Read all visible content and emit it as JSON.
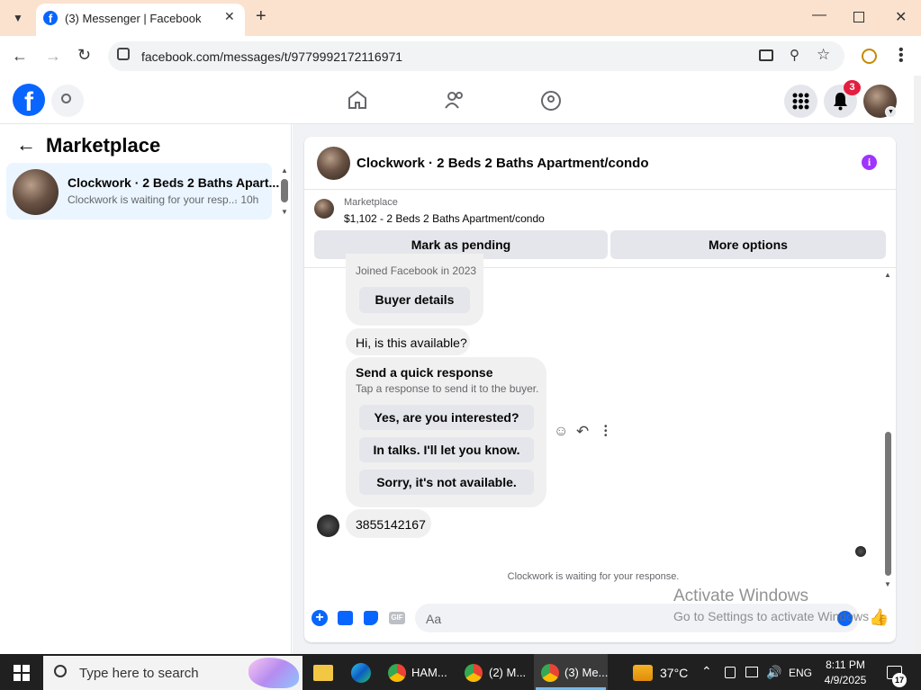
{
  "browser": {
    "tab_title": "(3) Messenger | Facebook",
    "url": "facebook.com/messages/t/9779992172116971"
  },
  "header": {
    "notification_count": "3"
  },
  "sidebar": {
    "title": "Marketplace",
    "conversations": [
      {
        "title": "Clockwork · 2 Beds 2 Baths Apart...",
        "preview": "Clockwork is waiting for your resp...",
        "time": "· 10h"
      }
    ]
  },
  "chat": {
    "title": "Clockwork · 2 Beds 2 Baths Apartment/condo",
    "listing": {
      "label": "Marketplace",
      "detail": "$1,102 - 2 Beds 2 Baths Apartment/condo"
    },
    "mark_pending_label": "Mark as pending",
    "more_options_label": "More options",
    "joined_text": "Joined Facebook in 2023",
    "buyer_details_label": "Buyer details",
    "first_message": "Hi, is this available?",
    "quick_response": {
      "title": "Send a quick response",
      "subtitle": "Tap a response to send it to the buyer.",
      "options": [
        "Yes, are you interested?",
        "In talks. I'll let you know.",
        "Sorry, it's not available."
      ]
    },
    "phone_message": "3855142167",
    "status_text": "Clockwork is waiting for your response.",
    "input_placeholder": "Aa"
  },
  "watermark": {
    "line1": "Activate Windows",
    "line2": "Go to Settings to activate Windows."
  },
  "taskbar": {
    "search_placeholder": "Type here to search",
    "apps": [
      "HAM...",
      "(2) M...",
      "(3) Me..."
    ],
    "temperature": "37°C",
    "language": "ENG",
    "time": "8:11 PM",
    "date": "4/9/2025",
    "notification_count": "17"
  },
  "colors": {
    "facebook_blue": "#0866ff",
    "accent_purple": "#a033ff"
  }
}
